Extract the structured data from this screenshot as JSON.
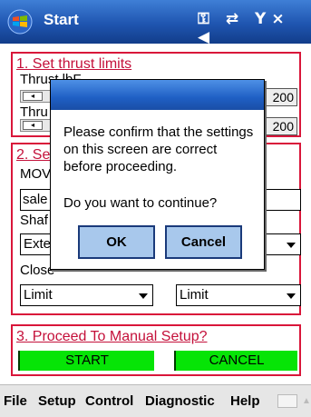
{
  "titlebar": {
    "title": "Start",
    "status_icons": "⚿ ⇄ Y× ◀"
  },
  "section1": {
    "title": "1. Set thrust limits",
    "thrust1_label": "Thrust lbF",
    "thrust1_value": "200",
    "thrust2_label": "Thru",
    "thrust2_value": "200"
  },
  "section2": {
    "title": "2. Se",
    "mov_label": "MOV",
    "field_value": "sale",
    "shaft_label": "Shaf",
    "dropdown1_value": "Exte",
    "close_label": "Close",
    "dropdown3_value": "Limit",
    "dropdown4_value": "Limit"
  },
  "section3": {
    "title": "3. Proceed To Manual Setup?",
    "start_label": "START",
    "cancel_label": "CANCEL"
  },
  "dialog": {
    "message": "Please confirm that the settings on this screen are correct before proceeding.",
    "question": "Do you want to continue?",
    "ok_label": "OK",
    "cancel_label": "Cancel"
  },
  "menubar": {
    "items": [
      "File",
      "Setup",
      "Control",
      "Diagnostic",
      "Help"
    ]
  },
  "colors": {
    "titlebar": "#1f55b0",
    "group_border": "#d9163a",
    "green_button": "#06e406",
    "dialog_button": "#a8c8ec"
  }
}
